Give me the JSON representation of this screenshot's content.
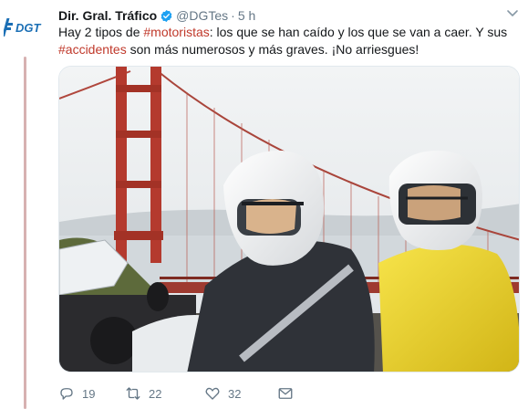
{
  "tweet": {
    "avatar_text": "DGT",
    "display_name": "Dir. Gral. Tráfico",
    "handle": "@DGTes",
    "separator": "·",
    "time": "5 h",
    "text_parts": {
      "p1": "Hay 2 tipos de ",
      "tag1": "#motoristas",
      "p2": ": los que se han caído y los que se van a caer. Y sus ",
      "tag2": "#accidentes",
      "p3": " son más numerosos y más graves. ¡No arriesgues!"
    },
    "media": {
      "icon": "photo-motorcyclists-golden-gate"
    },
    "actions": {
      "replies": "19",
      "retweets": "22",
      "likes": "32"
    }
  },
  "colors": {
    "hashtag": "#c0392b",
    "brand_blue": "#1b6fb5",
    "verified": "#1da1f2",
    "muted": "#657786",
    "thread_line": "#d7b1b1"
  }
}
